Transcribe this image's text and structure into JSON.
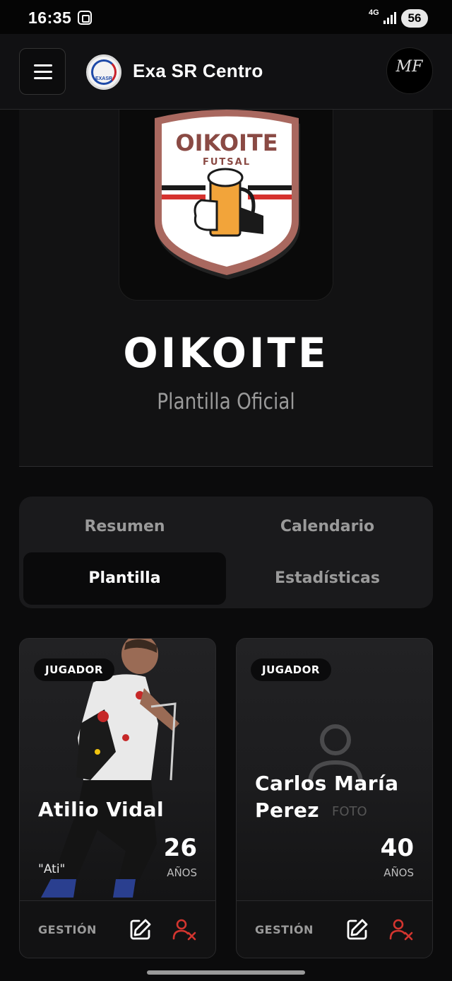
{
  "status_bar": {
    "time": "16:35",
    "network": "4G",
    "battery": "56"
  },
  "header": {
    "title": "Exa SR Centro",
    "app_logo_text": "EXASR",
    "profile_initials": "MF"
  },
  "team": {
    "crest_name": "OIKOITE",
    "crest_sub": "FUTSAL",
    "name": "OIKOITE",
    "subtitle": "Plantilla Oficial",
    "colors": {
      "crest_border": "#a9685f",
      "crest_fill": "#ffffff",
      "crest_text": "#8a4a44",
      "stripe_red": "#d6322e",
      "stripe_black": "#1a1a1a",
      "beer": "#f2a43a"
    }
  },
  "tabs": [
    {
      "label": "Resumen",
      "active": false
    },
    {
      "label": "Calendario",
      "active": false
    },
    {
      "label": "Plantilla",
      "active": true
    },
    {
      "label": "Estadísticas",
      "active": false
    }
  ],
  "players": [
    {
      "role": "JUGADOR",
      "name_line1": "Atilio Vidal",
      "name_line2": "",
      "nickname": "\"Ati\"",
      "age": "26",
      "age_unit": "AÑOS",
      "manage_label": "GESTIÓN",
      "has_photo": true,
      "no_photo_label": ""
    },
    {
      "role": "JUGADOR",
      "name_line1": "Carlos María",
      "name_line2": "Perez",
      "nickname": "",
      "age": "40",
      "age_unit": "AÑOS",
      "manage_label": "GESTIÓN",
      "has_photo": false,
      "no_photo_label": "FOTO"
    }
  ],
  "icons": {
    "menu": "hamburger-icon",
    "edit": "edit-icon",
    "remove": "remove-user-icon",
    "placeholder": "user-placeholder-icon"
  },
  "accent_colors": {
    "edit": "#ffffff",
    "remove": "#d3352f"
  }
}
